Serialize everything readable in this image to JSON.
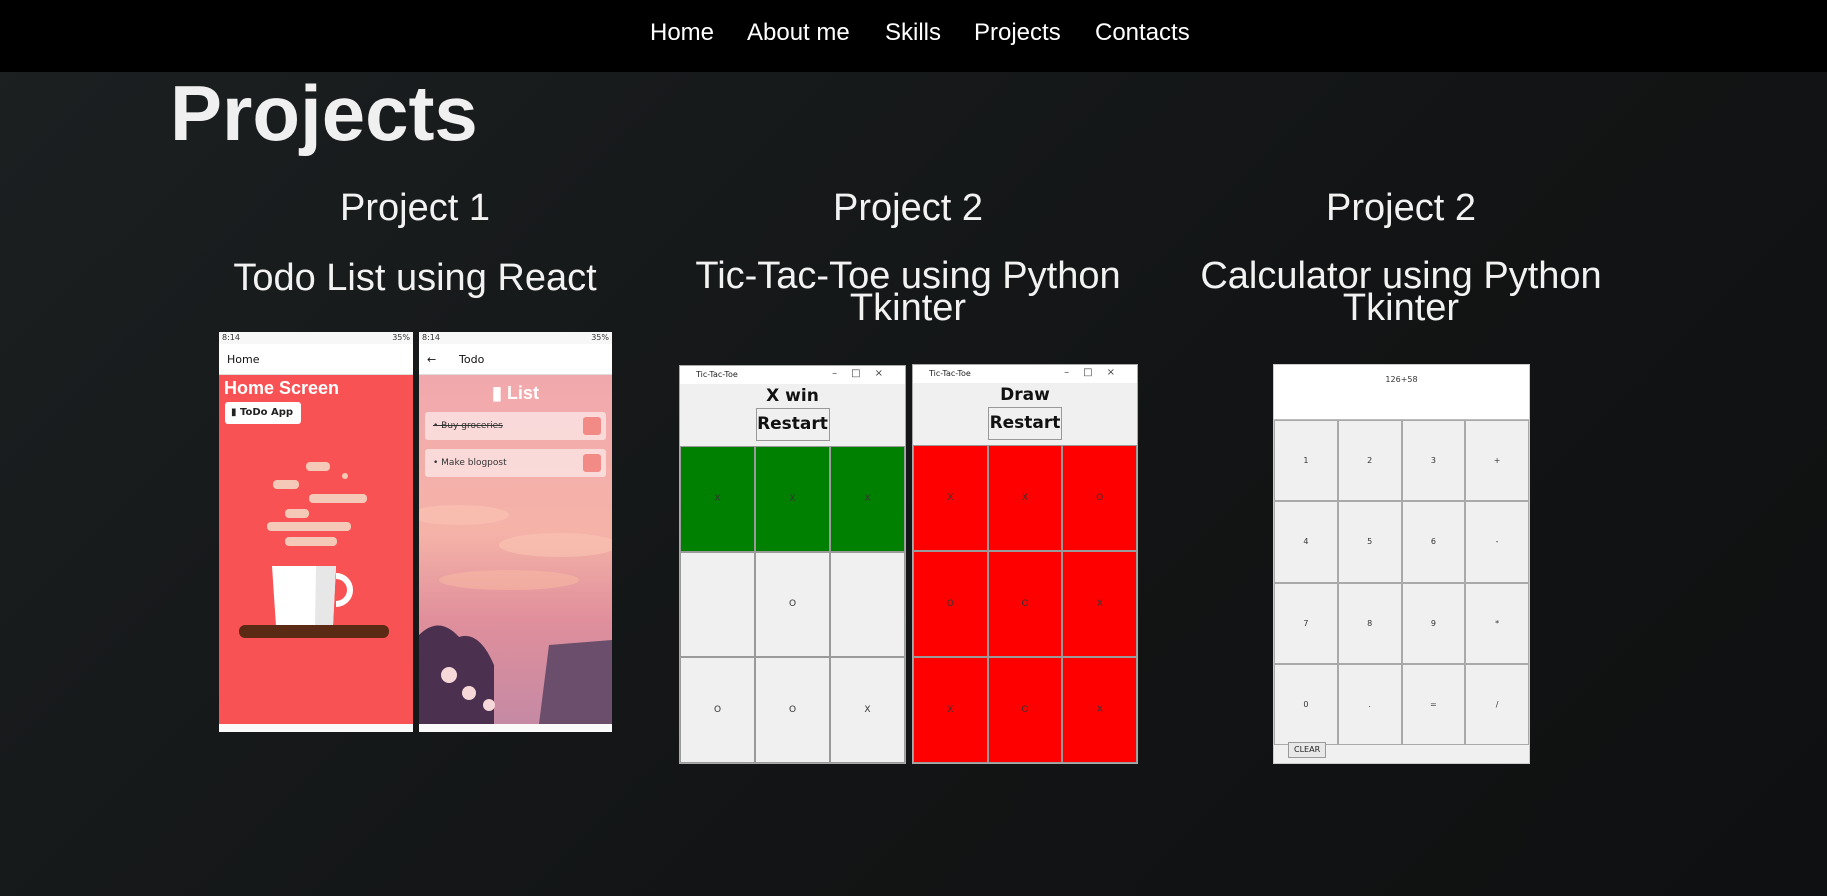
{
  "nav": [
    "Home",
    "About me",
    "Skills",
    "Projects",
    "Contacts"
  ],
  "page_title": "Projects",
  "projects": [
    {
      "number": "Project 1",
      "name": "Todo List using React",
      "home_shot": {
        "status_time": "8:14",
        "status_right": "35%",
        "appbar_title": "Home",
        "screen_title": "Home Screen",
        "button_label": "ToDo App"
      },
      "todo_shot": {
        "status_time": "8:14",
        "status_right": "35%",
        "appbar_title": "Todo",
        "back_icon": "←",
        "list_title": "List",
        "items": [
          "• Buy groceries",
          "• Make blogpost"
        ]
      }
    },
    {
      "number": "Project 2",
      "name_line1": "Tic-Tac-Toe using Python",
      "name_line2": "Tkinter",
      "win_shot": {
        "window_title": "Tic-Tac-Toe",
        "status": "X win",
        "restart": "Restart",
        "cells": [
          "X",
          "X",
          "X",
          "",
          "O",
          "",
          "O",
          "O",
          "X"
        ],
        "win_color": "#008000"
      },
      "draw_shot": {
        "window_title": "Tic-Tac-Toe",
        "status": "Draw",
        "restart": "Restart",
        "cells": [
          "X",
          "X",
          "O",
          "O",
          "O",
          "X",
          "X",
          "O",
          "X"
        ],
        "draw_color": "#ff0000"
      }
    },
    {
      "number": "Project 2",
      "name_line1": "Calculator using Python",
      "name_line2": "Tkinter",
      "calc_shot": {
        "display": "126+58",
        "keys": [
          "1",
          "2",
          "3",
          "+",
          "4",
          "5",
          "6",
          "-",
          "7",
          "8",
          "9",
          "*",
          "0",
          ".",
          "=",
          "/"
        ],
        "clear": "CLEAR"
      }
    }
  ]
}
